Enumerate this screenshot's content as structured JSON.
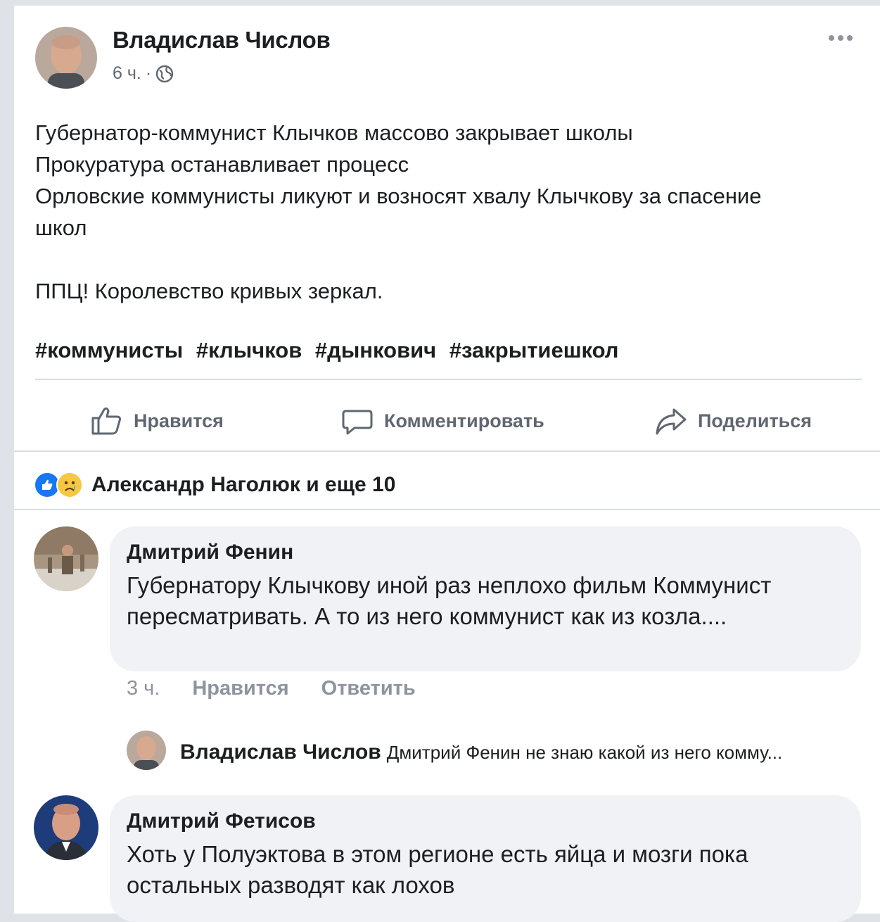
{
  "post": {
    "author": "Владислав Числов",
    "time": "6 ч.",
    "separator": "·",
    "text_lines": [
      "Губернатор-коммунист Клычков массово закрывает школы",
      "Прокуратура останавливает процесс",
      "Орловские коммунисты ликуют и возносят хвалу Клычкову за спасение школ"
    ],
    "text_line_2": "ППЦ! Королевство кривых зеркал.",
    "hashtags": [
      "#коммунисты",
      "#клычков",
      "#дынкович",
      "#закрытиешкол"
    ]
  },
  "actions": {
    "like": "Нравится",
    "comment": "Комментировать",
    "share": "Поделиться"
  },
  "reactions": {
    "summary": "Александр Наголюк и еще 10"
  },
  "comments": [
    {
      "author": "Дмитрий Фенин",
      "text": "Губернатору Клычкову иной раз неплохо фильм Коммунист пересматривать. А то из него коммунист как из козла....",
      "time": "3 ч.",
      "like": "Нравится",
      "reply": "Ответить"
    },
    {
      "author": "Дмитрий Фетисов",
      "text": "Хоть у Полуэктова в этом регионе есть яйца и мозги пока остальных разводят как лохов"
    }
  ],
  "reply_preview": {
    "author": "Владислав Числов",
    "text": "Дмитрий Фенин не знаю какой из него комму..."
  }
}
